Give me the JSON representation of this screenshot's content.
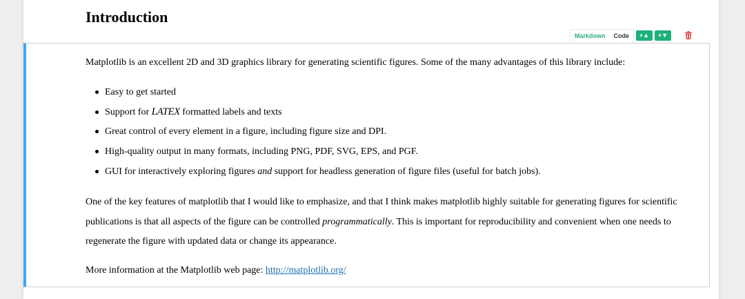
{
  "heading": "Introduction",
  "cell_toolbar": {
    "markdown_label": "Markdown",
    "code_label": "Code",
    "add_above_label": "+▲",
    "add_below_label": "+▼",
    "delete_icon": "trash-icon"
  },
  "colors": {
    "cell_accent": "#42a5f5",
    "markdown_active": "#2db27d",
    "add_button": "#1db07a",
    "delete": "#e05050",
    "link": "#1a6fb5"
  },
  "intro": "Matplotlib is an excellent 2D and 3D graphics library for generating scientific figures. Some of the many advantages of this library include:",
  "features": [
    {
      "text": "Easy to get started"
    },
    {
      "before": "Support for ",
      "latex": "LATEX",
      "after": " formatted labels and texts"
    },
    {
      "text": "Great control of every element in a figure, including figure size and DPI."
    },
    {
      "text": "High-quality output in many formats, including PNG, PDF, SVG, EPS, and PGF."
    },
    {
      "before": "GUI for interactively exploring figures ",
      "emph": "and",
      "after": " support for headless generation of figure files (useful for batch jobs)."
    }
  ],
  "key_features": {
    "before": "One of the key features of matplotlib that I would like to emphasize, and that I think makes matplotlib highly suitable for generating figures for scientific publications is that all aspects of the figure can be controlled ",
    "emph": "programmatically",
    "after": ". This is important for reproducibility and convenient when one needs to regenerate the figure with updated data or change its appearance."
  },
  "more_info": {
    "text": "More information at the Matplotlib web page: ",
    "link_text": "http://matplotlib.org/"
  }
}
